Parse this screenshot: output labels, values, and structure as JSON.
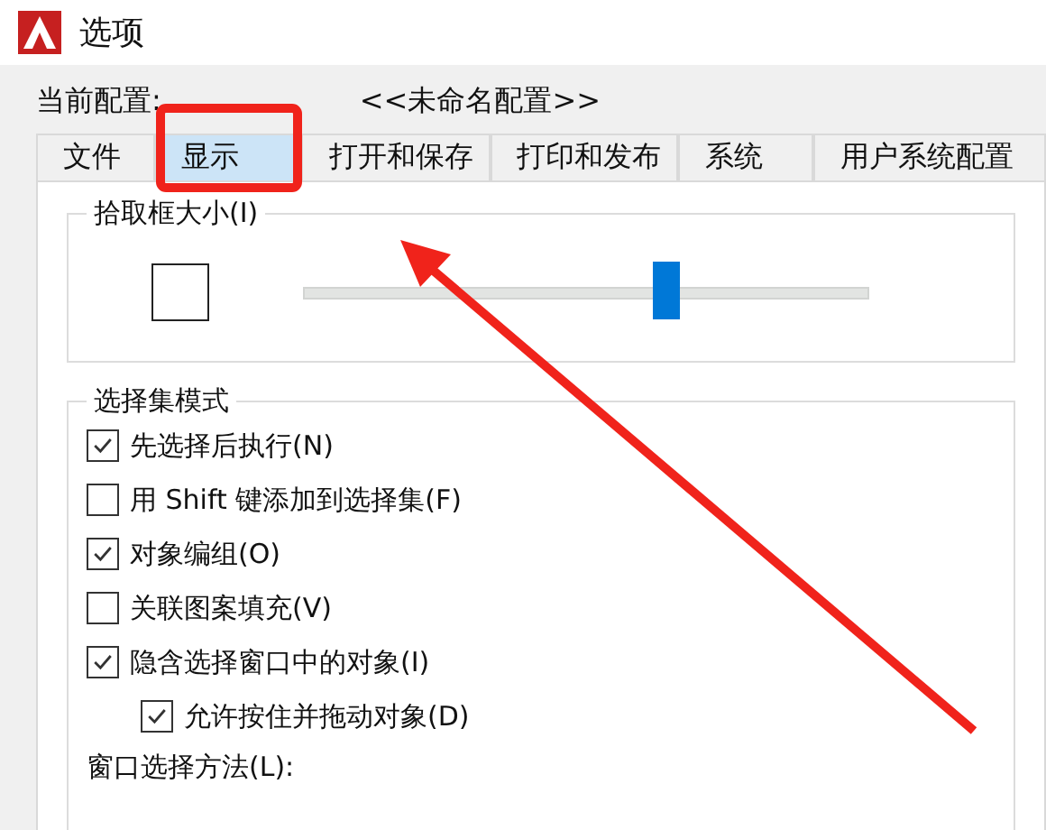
{
  "window": {
    "title": "选项"
  },
  "profile": {
    "label": "当前配置:",
    "value": "<<未命名配置>>"
  },
  "tabs": [
    {
      "label": "文件",
      "selected": false
    },
    {
      "label": "显示",
      "selected": true
    },
    {
      "label": "打开和保存",
      "selected": false
    },
    {
      "label": "打印和发布",
      "selected": false
    },
    {
      "label": "系统",
      "selected": false
    },
    {
      "label": "用户系统配置",
      "selected": false
    }
  ],
  "pickbox": {
    "title": "拾取框大小(I)",
    "level": 0.64
  },
  "selection_modes": {
    "title": "选择集模式",
    "options": [
      {
        "label": "先选择后执行(N)",
        "checked": true
      },
      {
        "label": "用 Shift 键添加到选择集(F)",
        "checked": false
      },
      {
        "label": "对象编组(O)",
        "checked": true
      },
      {
        "label": "关联图案填充(V)",
        "checked": false
      },
      {
        "label": "隐含选择窗口中的对象(I)",
        "checked": true,
        "children": [
          {
            "label": "允许按住并拖动对象(D)",
            "checked": true
          }
        ]
      }
    ],
    "window_method_label": "窗口选择方法(L):"
  }
}
